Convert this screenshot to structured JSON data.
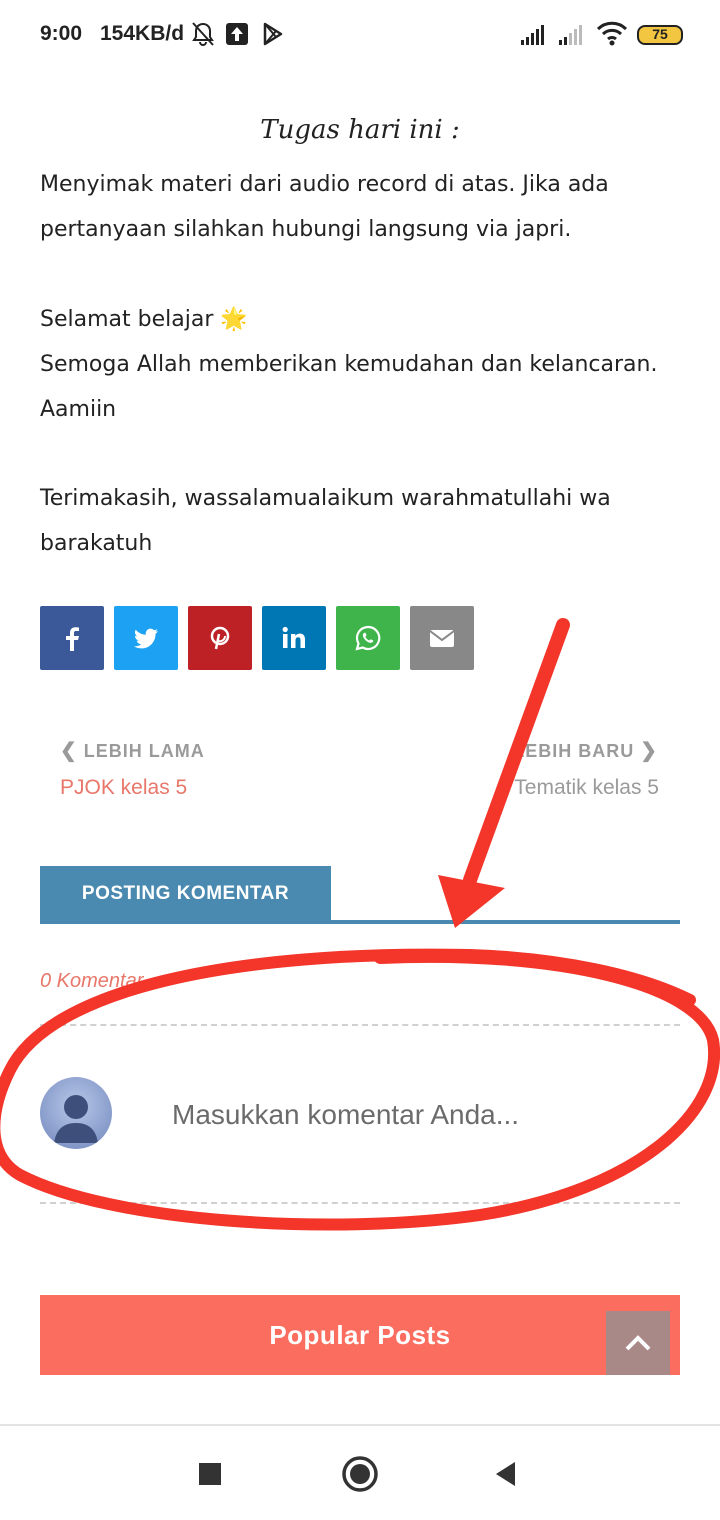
{
  "status_bar": {
    "time": "9:00",
    "network_speed": "154KB/d",
    "battery_level": "75",
    "icons": [
      "bell-off-icon",
      "upload-icon",
      "play-store-icon",
      "signal-icon",
      "signal-icon",
      "wifi-icon",
      "battery-icon"
    ]
  },
  "article": {
    "heading": "Tugas hari ini :",
    "paragraph1_line1": "Menyimak materi dari audio record di atas. Jika ada",
    "paragraph1_line2": "pertanyaan silahkan hubungi langsung via japri.",
    "paragraph2_line1": "Selamat belajar 🌟",
    "paragraph2_line2": "Semoga Allah memberikan kemudahan dan kelancaran.",
    "paragraph2_line3": "Aamiin",
    "paragraph3_line1": "Terimakasih, wassalamualaikum warahmatullahi wa",
    "paragraph3_line2": "barakatuh"
  },
  "share_buttons": [
    {
      "name": "facebook",
      "icon": "facebook-icon",
      "color": "#3b5998"
    },
    {
      "name": "twitter",
      "icon": "twitter-icon",
      "color": "#1da1f2"
    },
    {
      "name": "pinterest",
      "icon": "pinterest-icon",
      "color": "#bd2126"
    },
    {
      "name": "linkedin",
      "icon": "linkedin-icon",
      "color": "#0077b5"
    },
    {
      "name": "whatsapp",
      "icon": "whatsapp-icon",
      "color": "#3fb44b"
    },
    {
      "name": "email",
      "icon": "envelope-icon",
      "color": "#888888"
    }
  ],
  "post_nav": {
    "older_label": "LEBIH LAMA",
    "older_title": "PJOK kelas 5",
    "newer_label": "LEBIH BARU",
    "newer_title": "Tematik kelas 5"
  },
  "comments": {
    "tab_label": "POSTING KOMENTAR",
    "count_text": "0 Komentar",
    "input_placeholder": "Masukkan komentar Anda..."
  },
  "popular": {
    "title": "Popular Posts"
  },
  "colors": {
    "accent_blue": "#4a8ab0",
    "accent_coral": "#fb6d5e",
    "annotation_red": "#f3352a"
  },
  "nav_bar": {
    "icons": [
      "recents-square-icon",
      "home-circle-icon",
      "back-triangle-icon"
    ]
  }
}
